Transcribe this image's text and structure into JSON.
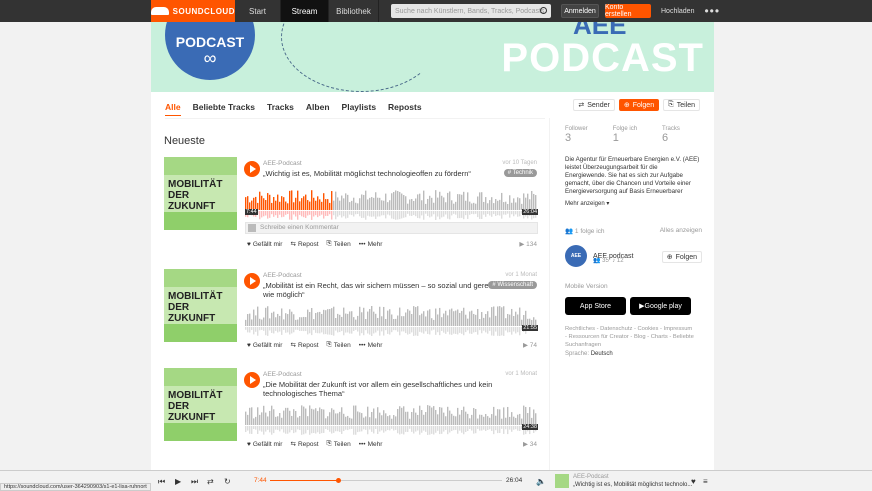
{
  "topbar": {
    "logo": "SOUNDCLOUD",
    "nav": [
      "Start",
      "Stream",
      "Bibliothek"
    ],
    "search_placeholder": "Suche nach Künstlern, Bands, Tracks, Podcasts",
    "login": "Anmelden",
    "signup": "Konto erstellen",
    "upload": "Hochladen",
    "more": "•••"
  },
  "banner": {
    "circle_text": "PODCAST",
    "infinity": "∞",
    "big_text": "PODCAST",
    "partial_text": "AEE"
  },
  "tabs": [
    "Alle",
    "Beliebte Tracks",
    "Tracks",
    "Alben",
    "Playlists",
    "Reposts"
  ],
  "actions": {
    "station": "Sender",
    "follow": "Folgen",
    "share": "Teilen"
  },
  "section_title": "Neueste",
  "art_text": "MOBILITÄT DER ZUKUNFT",
  "tracks": [
    {
      "user": "AEE-Podcast",
      "title": "„Wichtig ist es, Mobilität möglichst technologieoffen zu fördern“",
      "age": "vor 10 Tagen",
      "tag": "# Technik",
      "start": "7:44",
      "duration": "26:04",
      "comment": "Schreibe einen Kommentar",
      "like": "Gefällt mir",
      "repost": "Repost",
      "share": "Teilen",
      "more": "Mehr",
      "plays": "134"
    },
    {
      "user": "AEE-Podcast",
      "title": "„Mobilität ist ein Recht, das wir sichern müssen – so sozial und gerecht wie möglich“",
      "age": "vor 1 Monat",
      "tag": "# Wissenschaft",
      "duration": "21:55",
      "like": "Gefällt mir",
      "repost": "Repost",
      "share": "Teilen",
      "more": "Mehr",
      "plays": "74"
    },
    {
      "user": "AEE-Podcast",
      "title": "„Die Mobilität der Zukunft ist vor allem ein gesellschaftliches und kein technologisches Thema“",
      "age": "vor 1 Monat",
      "duration": "24:38",
      "like": "Gefällt mir",
      "repost": "Repost",
      "share": "Teilen",
      "more": "Mehr",
      "plays": "34"
    }
  ],
  "sidebar": {
    "stats": [
      {
        "label": "Follower",
        "value": "3"
      },
      {
        "label": "Folge ich",
        "value": "1"
      },
      {
        "label": "Tracks",
        "value": "6"
      }
    ],
    "bio": "Die Agentur für Erneuerbare Energien e.V. (AEE) leistet Überzeugungsarbeit für die Energiewende. Sie hat es sich zur Aufgabe gemacht, über die Chancen und Vorteile einer Energieversorgung auf Basis Erneuerbarer Energien aufzuklären – vom",
    "show_more": "Mehr anzeigen ▾",
    "following_label": "1 folge ich",
    "show_all": "Alles anzeigen",
    "following": {
      "name": "AEE podcast",
      "avatar_text": "AEE PODCAST",
      "followers": "35",
      "tracks": "12",
      "button": "Folgen"
    },
    "mobile": "Mobile Version",
    "appstore": "App Store",
    "googleplay": "Google play",
    "legal": "Rechtliches - Datenschutz - Cookies - Impressum - Ressourcen für Creator - Blog - Charts - Beliebte Suchanfragen",
    "language_label": "Sprache:",
    "language": "Deutsch"
  },
  "player": {
    "current": "7:44",
    "duration": "26:04",
    "user": "AEE-Podcast",
    "title": "„Wichtig ist es, Mobilität möglichst technolo..."
  },
  "status_url": "https://soundcloud.com/user-364290903/s1-e1-lisa-ruhnort",
  "colors": {
    "accent": "#ff5500",
    "banner": "#c8f0dc",
    "brand_blue": "#3a6bb5"
  }
}
